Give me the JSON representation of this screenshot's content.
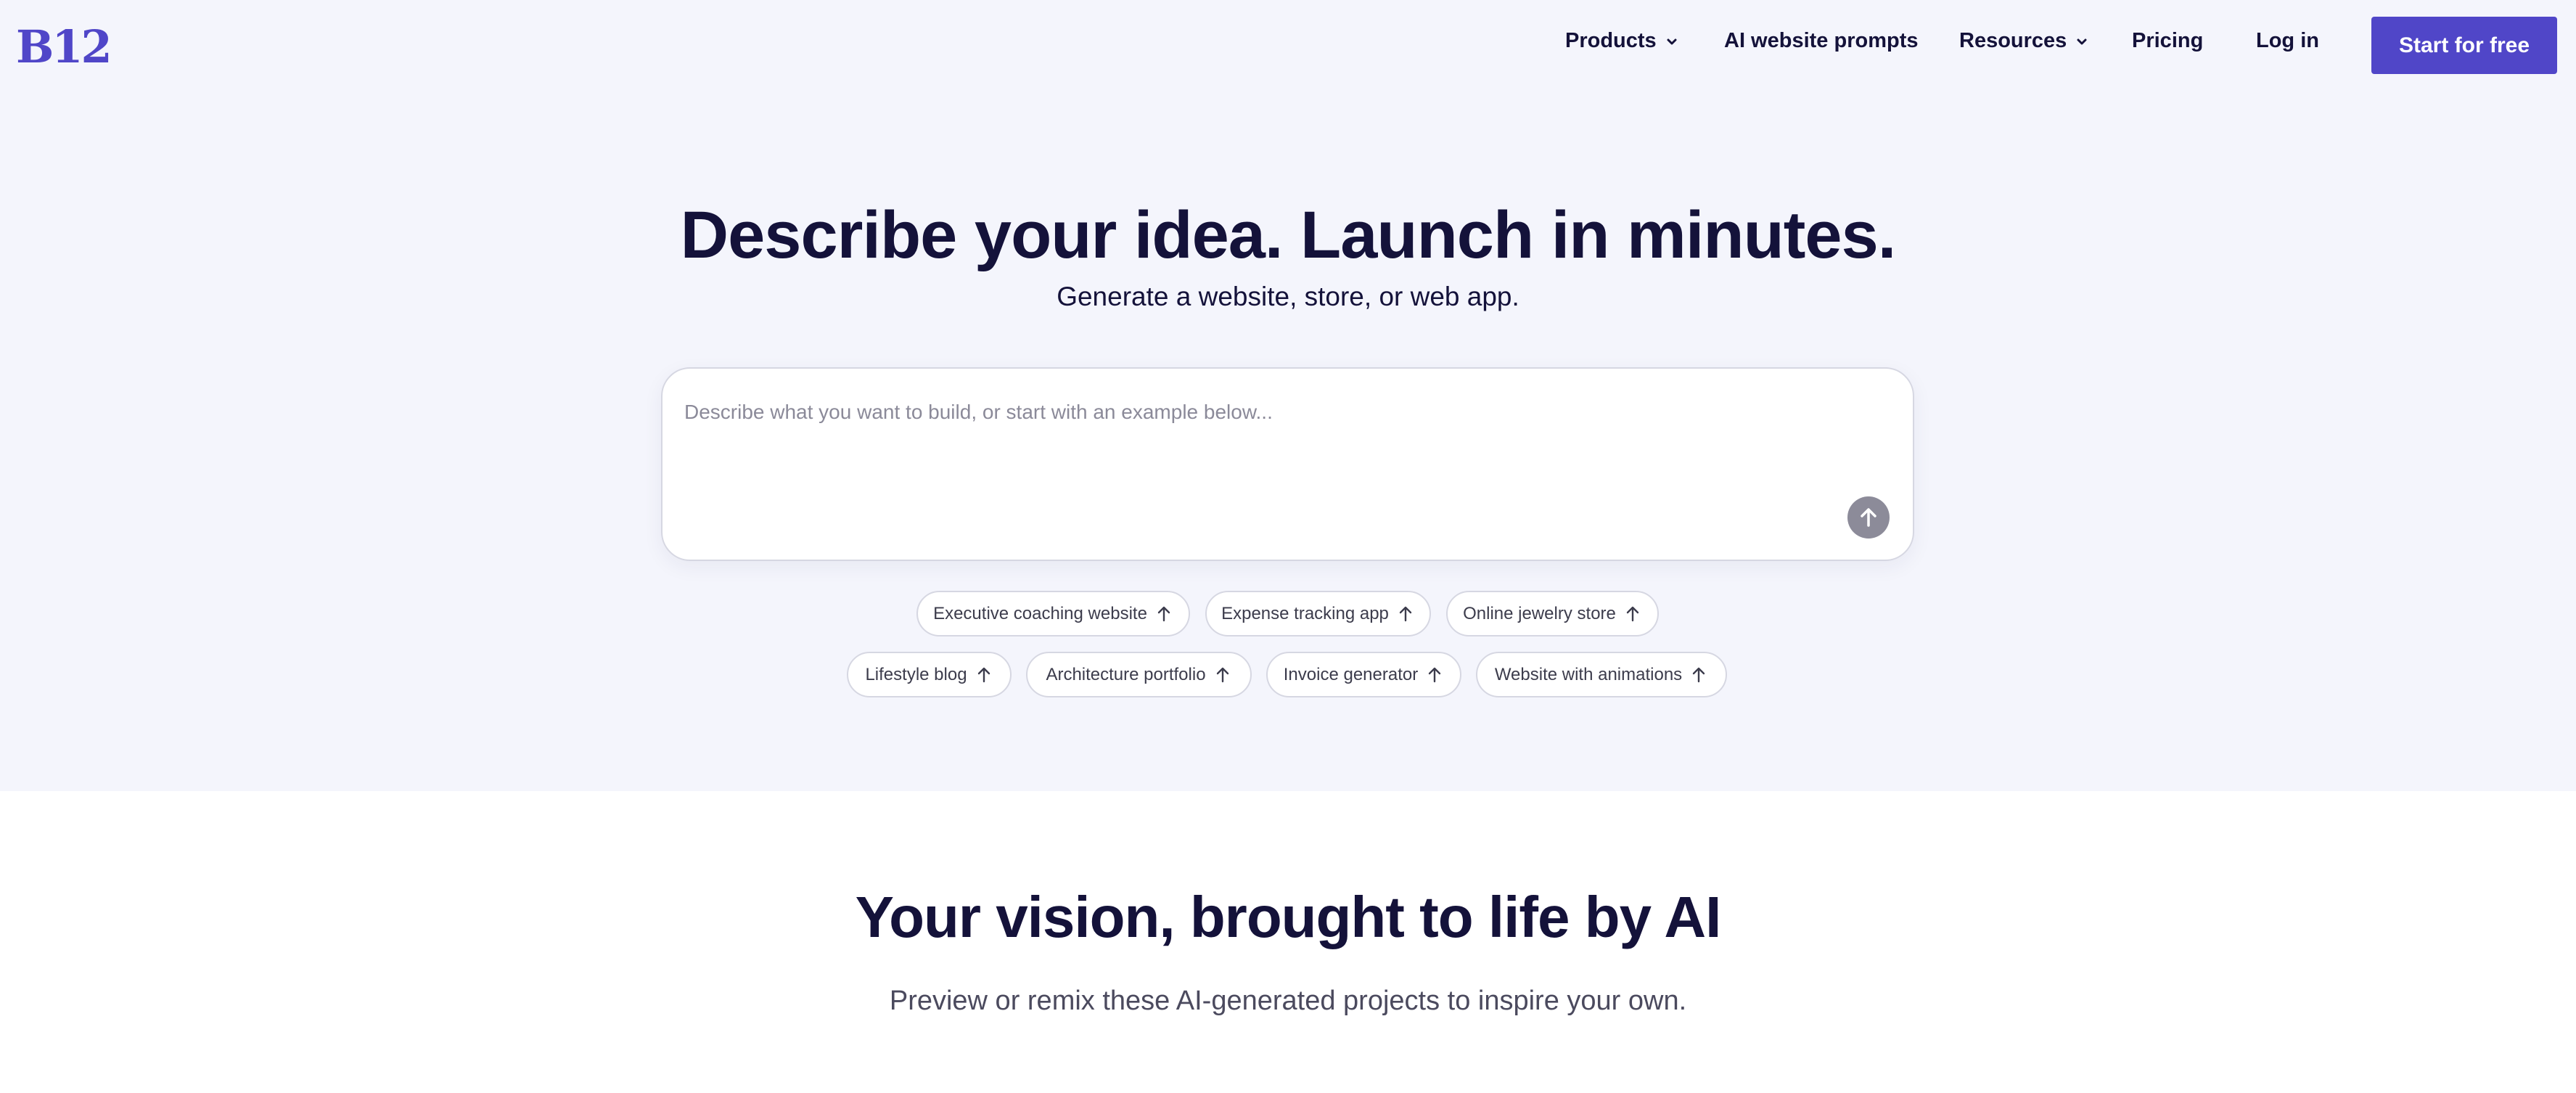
{
  "header": {
    "logo": "B12",
    "nav": {
      "products": "Products",
      "ai_prompts": "AI website prompts",
      "resources": "Resources",
      "pricing": "Pricing",
      "login": "Log in"
    },
    "cta": "Start for free"
  },
  "hero": {
    "title": "Describe your idea. Launch in minutes.",
    "subtitle": "Generate a website, store, or web app.",
    "prompt_placeholder": "Describe what you want to build, or start with an example below...",
    "examples": [
      "Executive coaching website",
      "Expense tracking app",
      "Online jewelry store",
      "Lifestyle blog",
      "Architecture portfolio",
      "Invoice generator",
      "Website with animations"
    ]
  },
  "showcase": {
    "title": "Your vision, brought to life by AI",
    "subtitle": "Preview or remix these AI-generated projects to inspire your own."
  },
  "colors": {
    "brand": "#5046c8",
    "hero_bg": "#f4f5fc",
    "text": "#14123a"
  },
  "icons": {
    "dropdown": "chevron-down-icon",
    "send": "arrow-up-icon"
  }
}
